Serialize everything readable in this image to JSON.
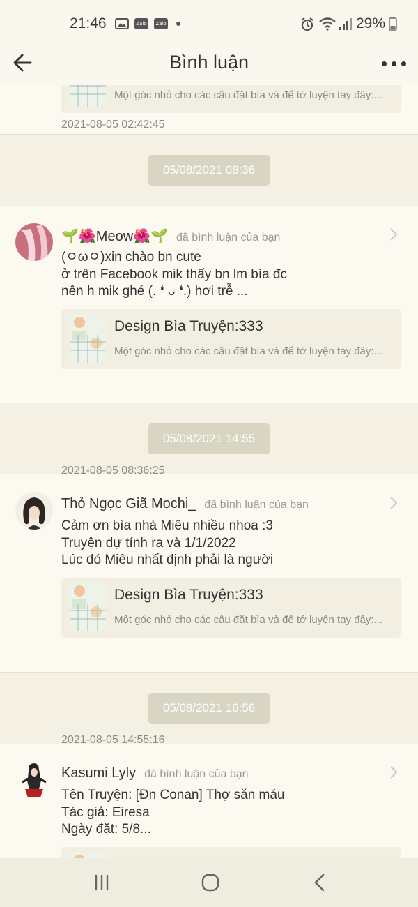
{
  "status_bar": {
    "time": "21:46",
    "zalo1": "Zalo",
    "zalo2": "Zalo",
    "battery": "29%"
  },
  "header": {
    "title": "Bình luận"
  },
  "top_card": {
    "ref_subtitle": "Một góc nhỏ cho các cậu đặt bìa và để tớ luyện tay đây:...",
    "timestamp": "2021-08-05 02:42:45"
  },
  "date_separators": [
    "05/08/2021 08:36",
    "05/08/2021 14:55",
    "05/08/2021 16:56"
  ],
  "comments": [
    {
      "username": "🌱🌺Meow🌺🌱",
      "action": "đã bình luận của bạn",
      "text": "(ㅇωㅇ)xin chào bn cute\nở trên Facebook mik thấy bn lm bìa đc\nnên h mik ghé (. ❛ ᴗ ❛.) hơi trễ ...",
      "ref_title": "Design Bìa Truyện:333",
      "ref_subtitle": "Một góc nhỏ cho các cậu đặt bìa và để tớ luyện tay đây:...",
      "timestamp": "2021-08-05 08:36:25"
    },
    {
      "username": "Thỏ Ngọc Giã Mochi_",
      "action": "đã bình luận của bạn",
      "text": "Cảm ơn bìa nhà Miêu nhiều nhoa :3\nTruyện dự tính ra và 1/1/2022\nLúc đó Miêu nhất định phải là người",
      "ref_title": "Design Bìa Truyện:333",
      "ref_subtitle": "Một góc nhỏ cho các cậu đặt bìa và để tớ luyện tay đây:...",
      "timestamp": "2021-08-05 14:55:16"
    },
    {
      "username": "Kasumi Lyly",
      "action": "đã bình luận của bạn",
      "text": "Tên Truyện: [Đn Conan] Thợ săn máu\nTác giả: Eiresa\nNgày đặt: 5/8..."
    }
  ],
  "icons": {
    "back": "arrow-left-icon",
    "more": "more-dots-icon",
    "chevron": "chevron-right-icon",
    "nav_recent": "recent-apps-icon",
    "nav_home": "home-icon",
    "nav_back": "back-icon"
  },
  "colors": {
    "background": "#f4f1e4",
    "card": "#fbf9f0",
    "date_pill": "#d9d5c3",
    "ref_box": "#f2efe2"
  }
}
